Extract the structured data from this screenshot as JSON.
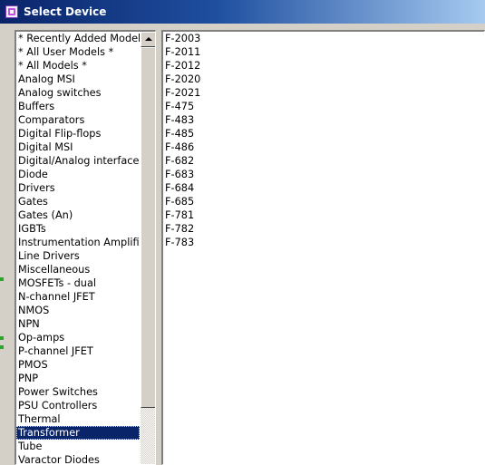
{
  "window": {
    "title": "Select Device"
  },
  "categories": [
    "* Recently Added Models",
    "* All User Models *",
    "* All Models *",
    "Analog MSI",
    "Analog switches",
    "Buffers",
    "Comparators",
    "Digital Flip-flops",
    "Digital MSI",
    "Digital/Analog interfaces",
    "Diode",
    "Drivers",
    "Gates",
    "Gates (An)",
    "IGBTs",
    "Instrumentation Amplifiers",
    "Line Drivers",
    "Miscellaneous",
    "MOSFETs - dual",
    "N-channel JFET",
    "NMOS",
    "NPN",
    "Op-amps",
    "P-channel JFET",
    "PMOS",
    "PNP",
    "Power Switches",
    "PSU Controllers",
    "Thermal",
    "Transformer",
    "Tube",
    "Varactor Diodes"
  ],
  "selected_category": "Transformer",
  "models": [
    "F-2003",
    "F-2011",
    "F-2012",
    "F-2020",
    "F-2021",
    "F-475",
    "F-483",
    "F-485",
    "F-486",
    "F-682",
    "F-683",
    "F-684",
    "F-685",
    "F-781",
    "F-782",
    "F-783"
  ],
  "icons": {
    "title_icon": "app-icon",
    "scroll_up": "chevron-up-icon"
  },
  "colors": {
    "selection": "#0a246a",
    "titlebar_start": "#0a246a",
    "titlebar_end": "#a6caf0"
  }
}
